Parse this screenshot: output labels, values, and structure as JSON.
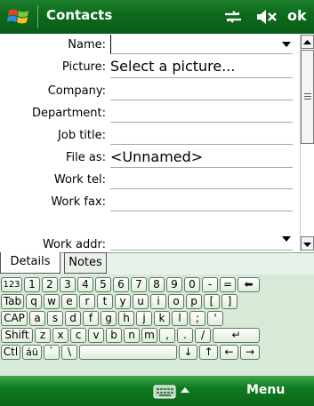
{
  "title_bar": {
    "app_title": "Contacts",
    "ok_label": "ok"
  },
  "form": {
    "fields": [
      {
        "label": "Name:",
        "value": ""
      },
      {
        "label": "Picture:",
        "value": "Select a picture..."
      },
      {
        "label": "Company:",
        "value": ""
      },
      {
        "label": "Department:",
        "value": ""
      },
      {
        "label": "Job title:",
        "value": ""
      },
      {
        "label": "File as:",
        "value": "<Unnamed>"
      },
      {
        "label": "Work tel:",
        "value": ""
      },
      {
        "label": "Work fax:",
        "value": ""
      },
      {
        "label": "Work addr:",
        "value": ""
      }
    ]
  },
  "tabs": {
    "details": "Details",
    "notes": "Notes",
    "selected": "Details"
  },
  "keyboard": {
    "row1": [
      "123",
      "1",
      "2",
      "3",
      "4",
      "5",
      "6",
      "7",
      "8",
      "9",
      "0",
      "-",
      "=",
      "⬅"
    ],
    "row2": [
      "Tab",
      "q",
      "w",
      "e",
      "r",
      "t",
      "y",
      "u",
      "i",
      "o",
      "p",
      "[",
      "]"
    ],
    "row3": [
      "CAP",
      "a",
      "s",
      "d",
      "f",
      "g",
      "h",
      "j",
      "k",
      "l",
      ";",
      "'"
    ],
    "row4": [
      "Shift",
      "z",
      "x",
      "c",
      "v",
      "b",
      "n",
      "m",
      ",",
      ".",
      "/",
      "↵"
    ],
    "row5": [
      "Ctl",
      "áü",
      "`",
      "\\",
      "",
      "↓",
      "↑",
      "←",
      "→"
    ]
  },
  "bottom_bar": {
    "menu_label": "Menu"
  },
  "colors": {
    "bar_green": "#0d6a1c",
    "keyboard_bg": "#d7e9d7",
    "tab_bg": "#e8f2e8"
  }
}
